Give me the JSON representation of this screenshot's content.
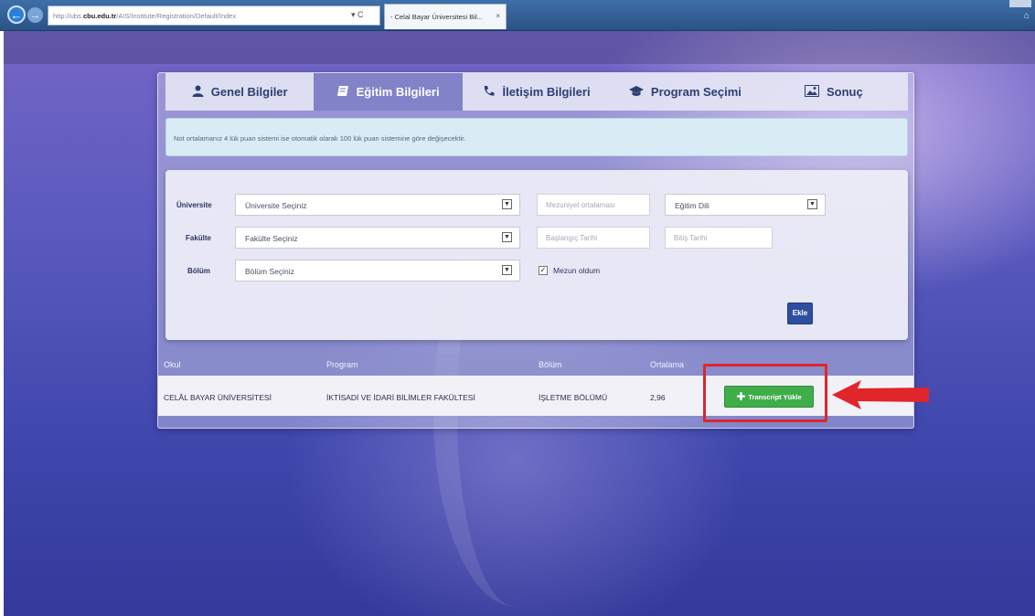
{
  "browser": {
    "url_prefix": "http://ubs.",
    "url_domain": "cbu.edu.tr",
    "url_path": "/AIS/Institute/Registration/Default/Index",
    "address_controls": "▾ C",
    "tab_title": "- Celal Bayar Üniversitesi Bil...",
    "tab_close": "×"
  },
  "tabs": [
    {
      "label": "Genel Bilgiler",
      "icon": "user-icon",
      "active": false
    },
    {
      "label": "Eğitim Bilgileri",
      "icon": "book-icon",
      "active": true
    },
    {
      "label": "İletişim Bilgileri",
      "icon": "phone-icon",
      "active": false
    },
    {
      "label": "Program Seçimi",
      "icon": "graduation-cap-icon",
      "active": false
    },
    {
      "label": "Sonuç",
      "icon": "image-icon",
      "active": false
    }
  ],
  "notice": "Not ortalamanız 4 lük puan sistemi ise otomatik olarak 100 lük puan sistemine göre değişecektir.",
  "form": {
    "universite_label": "Üniversite",
    "universite_value": "Üniversite Seçiniz",
    "fakulte_label": "Fakülte",
    "fakulte_value": "Fakülte Seçiniz",
    "bolum_label": "Bölüm",
    "bolum_value": "Bölüm Seçiniz",
    "mezuniyet_placeholder": "Mezuniyet ortalaması",
    "egitim_dili_value": "Eğitim Dili",
    "baslangic_placeholder": "Başlangıç Tarihi",
    "bitis_placeholder": "Bitiş Tarihi",
    "mezun_checked": true,
    "mezun_label": "Mezun oldum",
    "ekle_label": "Ekle"
  },
  "table": {
    "headers": [
      "Okul",
      "Program",
      "Bölüm",
      "Ortalama"
    ],
    "row": {
      "okul": "CELÂL BAYAR ÜNİVERSİTESİ",
      "program": "İKTİSADİ VE İDARİ BİLİMLER FAKÜLTESİ",
      "bolum": "İŞLETME BÖLÜMÜ",
      "ortalama": "2,96",
      "upload_label": "Transcript Yükle"
    }
  },
  "colors": {
    "accent": "#2e4fa0",
    "upload_green": "#3fae4a",
    "highlight_red": "#e0252b"
  }
}
